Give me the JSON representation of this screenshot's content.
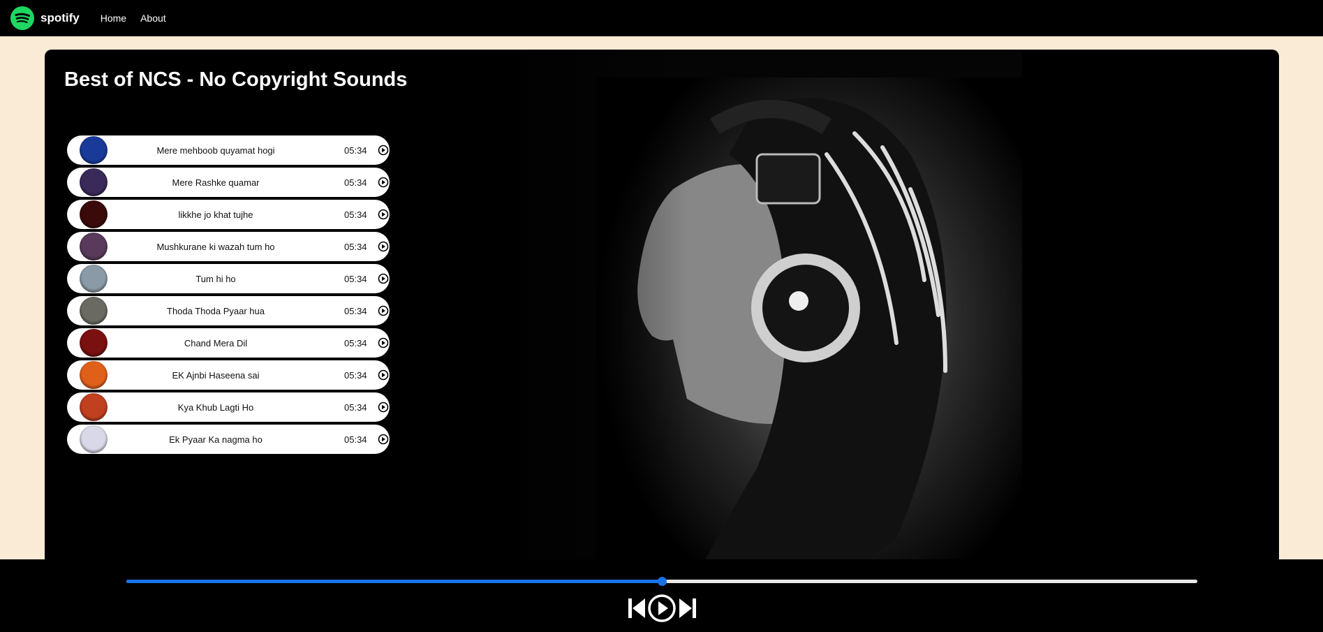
{
  "nav": {
    "brand": "spotify",
    "links": [
      "Home",
      "About"
    ]
  },
  "playlist": {
    "title": "Best of NCS - No Copyright Sounds",
    "songs": [
      {
        "name": "Mere mehboob quyamat hogi",
        "duration": "05:34",
        "cover": "#1a3a9a"
      },
      {
        "name": "Mere Rashke quamar",
        "duration": "05:34",
        "cover": "#3a2a5a"
      },
      {
        "name": "likkhe jo khat tujhe",
        "duration": "05:34",
        "cover": "#3a0a0a"
      },
      {
        "name": "Mushkurane ki wazah tum ho",
        "duration": "05:34",
        "cover": "#5a3a5a"
      },
      {
        "name": "Tum hi ho",
        "duration": "05:34",
        "cover": "#8a9aa6"
      },
      {
        "name": "Thoda Thoda Pyaar hua",
        "duration": "05:34",
        "cover": "#6a6a62"
      },
      {
        "name": "Chand Mera Dil",
        "duration": "05:34",
        "cover": "#7a1010"
      },
      {
        "name": "EK Ajnbi Haseena sai",
        "duration": "05:34",
        "cover": "#e0601a"
      },
      {
        "name": "Kya Khub Lagti Ho",
        "duration": "05:34",
        "cover": "#c04020"
      },
      {
        "name": "Ek Pyaar Ka nagma ho",
        "duration": "05:34",
        "cover": "#d8d8e8"
      }
    ]
  },
  "player": {
    "progress_percent": 50,
    "accent_color": "#1a73e8",
    "icons": [
      "previous-icon",
      "play-circle-icon",
      "next-icon"
    ]
  },
  "colors": {
    "page_bg": "#faebd7",
    "brand": "#1ed760"
  }
}
